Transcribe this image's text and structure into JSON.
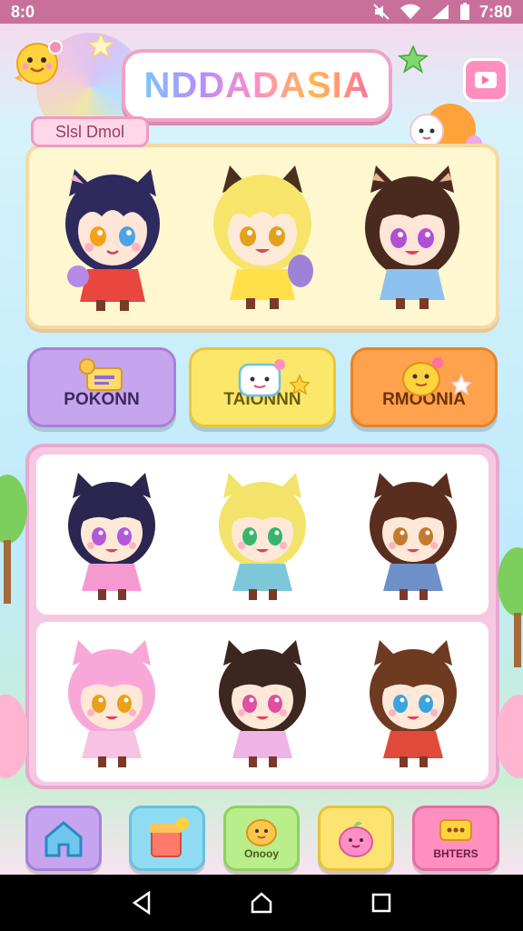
{
  "status_bar": {
    "time_left": "8:0",
    "time_right": "7:80"
  },
  "header": {
    "title": "NDDADASIA"
  },
  "featured": {
    "tag": "Slsl Dmol",
    "characters": [
      {
        "hair": "#2e2a5e",
        "eyes_left": "#f4a21a",
        "eyes_right": "#4aa3e8",
        "outfit": "#e8463e"
      },
      {
        "hair": "#f6e56a",
        "eyes_left": "#e3a11c",
        "eyes_right": "#e3a11c",
        "outfit": "#ffe04a"
      },
      {
        "hair": "#4a2a1f",
        "eyes_left": "#b14fd6",
        "eyes_right": "#b14fd6",
        "outfit": "#8ec2ee"
      }
    ]
  },
  "categories": [
    {
      "label": "POKONN",
      "icon": "mail-icon"
    },
    {
      "label": "TAIONNN",
      "icon": "cloud-face-icon"
    },
    {
      "label": "RMOONIA",
      "icon": "chick-icon"
    }
  ],
  "grid": {
    "characters": [
      {
        "hair": "#2a2650",
        "eyes": "#b05ad8",
        "outfit": "#f59ad1"
      },
      {
        "hair": "#f3e36b",
        "eyes": "#37b56d",
        "outfit": "#7cc7d8"
      },
      {
        "hair": "#5a2e1e",
        "eyes": "#c57b2c",
        "outfit": "#6f8fc9"
      },
      {
        "hair": "#f7a8d8",
        "eyes": "#e8a21a",
        "outfit": "#f8c2e2"
      },
      {
        "hair": "#3d2520",
        "eyes": "#e04fa2",
        "outfit": "#f0b3e6"
      },
      {
        "hair": "#6e3a20",
        "eyes": "#3ba3e0",
        "outfit": "#e04a3a"
      }
    ]
  },
  "bottom_nav": [
    {
      "label": "",
      "icon": "home-icon"
    },
    {
      "label": "",
      "icon": "shop-bag-icon"
    },
    {
      "label": "Onooy",
      "icon": "chick-icon"
    },
    {
      "label": "",
      "icon": "pet-icon"
    },
    {
      "label": "BHTERS",
      "icon": "chat-icon"
    }
  ],
  "colors": {
    "accent": "#ff8fbf",
    "status_bar": "#c9709a"
  }
}
